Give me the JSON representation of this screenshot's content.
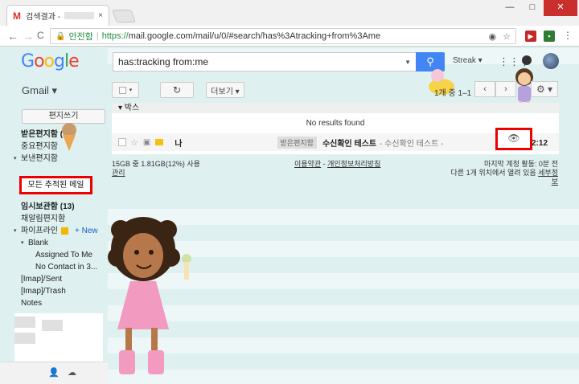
{
  "browser": {
    "tab_title": "검색결과 -",
    "tab_close": "×",
    "secure_label": "안전함",
    "url_prefix": "https://",
    "url_rest": "mail.google.com/mail/u/0/#search/has%3Atracking+from%3Ame",
    "window_controls": [
      "—",
      "□",
      "✕"
    ],
    "nav": {
      "back": "←",
      "forward": "→",
      "reload": "C"
    }
  },
  "gmail": {
    "logo": "Google",
    "search_query": "has:tracking from:me",
    "streak": "Streak ▾",
    "app_label": "Gmail ▾",
    "toolbar": {
      "select": "▾",
      "refresh": "↻",
      "more": "더보기 ▾"
    },
    "pager": "1개 중 1–1",
    "prev": "‹",
    "next": "›",
    "settings": "⚙ ▾"
  },
  "sidebar": {
    "compose": "편지쓰기",
    "items": [
      {
        "label": "받은편지함 (5)",
        "bold": true,
        "indent": 26
      },
      {
        "label": "중요편지함",
        "bold": false,
        "indent": 26
      },
      {
        "label": "보낸편지함",
        "bold": false,
        "indent": 26,
        "expand": "▾"
      },
      {
        "label": "",
        "bold": false,
        "indent": 26
      },
      {
        "label": "",
        "bold": false,
        "indent": 26
      },
      {
        "label": "",
        "bold": false,
        "indent": 26
      },
      {
        "label": "임시보관함 (13)",
        "bold": true,
        "indent": 26
      },
      {
        "label": "채알림편지함",
        "bold": false,
        "indent": 26
      },
      {
        "label": "파이프라인",
        "bold": false,
        "indent": 26,
        "expand": "▾",
        "new": "+ New"
      },
      {
        "label": "Blank",
        "bold": false,
        "indent": 35,
        "expand": "▾"
      },
      {
        "label": "Assigned To Me",
        "bold": false,
        "indent": 44
      },
      {
        "label": "No Contact in 3...",
        "bold": false,
        "indent": 44
      },
      {
        "label": "[Imap]/Sent",
        "bold": false,
        "indent": 26
      },
      {
        "label": "[Imap]/Trash",
        "bold": false,
        "indent": 26
      },
      {
        "label": "Notes",
        "bold": false,
        "indent": 26
      }
    ],
    "highlighted": "모든 추적된 메일"
  },
  "maillist": {
    "section": "▾ 박스",
    "no_results": "No results found",
    "row": {
      "sender": "나",
      "tag": "받은편지함",
      "subject": "수신확인 테스트",
      "snippet": "- 수신확인 테스트 -",
      "time": "2:12",
      "eye": "👁"
    }
  },
  "footer": {
    "storage": "15GB 중 1.81GB(12%) 사용",
    "manage": "관리",
    "terms": "이용약관",
    "privacy": "개인정보처리방침",
    "activity": "마지막 계정 활동: 0분 전",
    "other_location": "다른 1개 위치에서 열려 있음",
    "details": "세부정보"
  },
  "colors": {
    "highlight_border": "#e00",
    "search_blue": "#4285f4",
    "background": "#dff0f0"
  }
}
